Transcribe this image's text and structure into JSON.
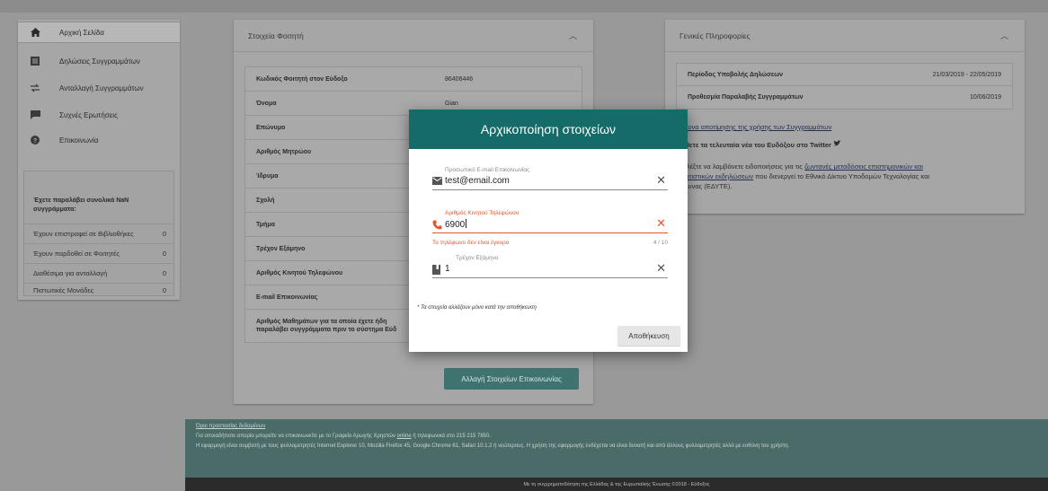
{
  "sidebar": {
    "items": [
      {
        "label": "Αρχική Σελίδα",
        "icon": "home-icon"
      },
      {
        "label": "Δηλώσεις Συγγραμμάτων",
        "icon": "list-icon"
      },
      {
        "label": "Ανταλλαγή Συγγραμμάτων",
        "icon": "swap-icon"
      },
      {
        "label": "Συχνές Ερωτήσεις",
        "icon": "chat-icon"
      },
      {
        "label": "Επικοινωνία",
        "icon": "help-icon"
      }
    ],
    "stats_title": "Έχετε παραλάβει συνολικά NaN συγγράμματα:",
    "stats": [
      {
        "label": "Έχουν επιστραφεί σε Βιβλιοθήκες",
        "value": "0"
      },
      {
        "label": "Έχουν παρδοθεί σε Φοιτητές",
        "value": "0"
      },
      {
        "label": "Διαθέσιμα για ανταλλαγή",
        "value": "0"
      },
      {
        "label": "Πιστωτικές Μονάδες",
        "value": "0"
      }
    ]
  },
  "student_card": {
    "title": "Στοιχεία Φοιτητή",
    "rows": [
      {
        "label": "Κωδικός Φοιτητή στον Εύδοξο",
        "value": "86406446"
      },
      {
        "label": "Όνομα",
        "value": "Gian"
      },
      {
        "label": "Επώνυμο",
        "value": ""
      },
      {
        "label": "Αριθμός Μητρώου",
        "value": ""
      },
      {
        "label": "Ίδρυμα",
        "value": ""
      },
      {
        "label": "Σχολή",
        "value": ""
      },
      {
        "label": "Τμήμα",
        "value": ""
      },
      {
        "label": "Τρέχον Εξάμηνο",
        "value": ""
      },
      {
        "label": "Αριθμός Κινητού Τηλεφώνου",
        "value": ""
      },
      {
        "label": "E-mail Επικοινωνίας",
        "value": ""
      }
    ],
    "last_row_line1": "Αριθμός Μαθημάτων για τα οποία έχετε ήδη",
    "last_row_line2": "παραλάβει συγγράμματα πριν το σύστημα Εύδ",
    "contact_button": "Αλλαγή Στοιχείων Επικοινωνίας"
  },
  "general_card": {
    "title": "Γενικές Πληροφορίες",
    "rows": [
      {
        "label": "Περίοδος Υποβολής Δηλώσεων",
        "value": "21/03/2019 - 22/05/2019"
      },
      {
        "label": "Προθεσμία Παραλαβής Συγγραμμάτων",
        "value": "10/06/2019"
      }
    ],
    "survey_link": "Έρευνα αποτίμησης της χρήσης των Συγγραμμάτων",
    "twitter_text": "Μάθετε τα τελευταία νέα του Ευδόξου στο Twitter",
    "notif_prefix": "Επιλέξτε να λαμβάνετε ειδοποιήσεις για τις ",
    "notif_link1": "ζωντανές μεταδόσεις επιστημονικών και",
    "notif_link2": "πολιτιστικών εκδηλώσεων",
    "notif_suffix1": " που διενεργεί το Εθνικό Δίκτυο Υποδομών Τεχνολογίας και",
    "notif_suffix2": "Έρευνας (ΕΔΥΤΕ)."
  },
  "footer": {
    "link": "Όροι προστασίας δεδομένων",
    "line2_prefix": "Για οποιαδήποτε απορία μπορείτε να επικοινωνείτε με το Γραφείο Αρωγής Χρηστών ",
    "line2_link": "online",
    "line2_suffix": " ή τηλεφωνικά στο 215 215 7850.",
    "line3": "Η εφαρμογή είναι συμβατή με τους φυλλομετρητές Internet Explorer 10, Mozilla Firefox 45, Google Chrome 61, Safari 10.1.2 ή νεώτερους. Η χρήση της εφαρμογής ενδέχεται να είναι δυνατή και από άλλους φυλλομετρητές αλλά με ευθύνη του χρήστη.",
    "bottom": "Με τη συγχρηματοδότηση της Ελλάδας & της Ευρωπαϊκής Ένωσης ©2018 - Εύδοξος"
  },
  "modal": {
    "title": "Αρχικοποίηση στοιχείων",
    "email": {
      "label": "Προσωπικό E-mail Επικοινωνίας",
      "value": "test@email.com",
      "icon": "mail-icon"
    },
    "phone": {
      "label": "Αριθμός Κινητού Τηλεφώνου",
      "value": "6900",
      "icon": "phone-icon",
      "error": "Το τηλέφωνο δεν είναι έγκυρο",
      "counter": "4 / 10"
    },
    "semester": {
      "label": "Τρέχον Εξάμηνο",
      "value": "1",
      "icon": "book-icon"
    },
    "note": "* Τα στοιχεία αλλάζουν μόνο κατά την αποθήκευση",
    "save": "Αποθήκευση",
    "clear_symbol": "✕"
  },
  "colors": {
    "accent": "#146b68",
    "error": "#e2562c",
    "footer": "#4b6b69"
  }
}
